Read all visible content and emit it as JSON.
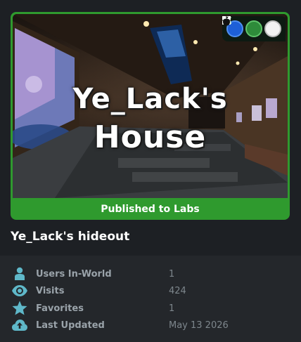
{
  "thumbnail": {
    "title_line1": "Ye_Lack's",
    "title_line2": "House",
    "status_banner": "Published to Labs"
  },
  "platforms": [
    {
      "icon": "windows-icon",
      "color": "#1e5fd6"
    },
    {
      "icon": "android-icon",
      "color": "#2e8b3a"
    },
    {
      "icon": "apple-icon",
      "color": "#f2f2f2"
    }
  ],
  "world": {
    "name": "Ye_Lack's hideout"
  },
  "stats": [
    {
      "icon": "user-icon",
      "label": "Users In-World",
      "value": "1"
    },
    {
      "icon": "eye-icon",
      "label": "Visits",
      "value": "424"
    },
    {
      "icon": "star-icon",
      "label": "Favorites",
      "value": "1"
    },
    {
      "icon": "cloud-upload-icon",
      "label": "Last Updated",
      "value": "May 13 2026"
    }
  ],
  "colors": {
    "labs_green": "#2f9a2e",
    "icon_teal": "#5fb8c9",
    "background": "#1d2024"
  }
}
